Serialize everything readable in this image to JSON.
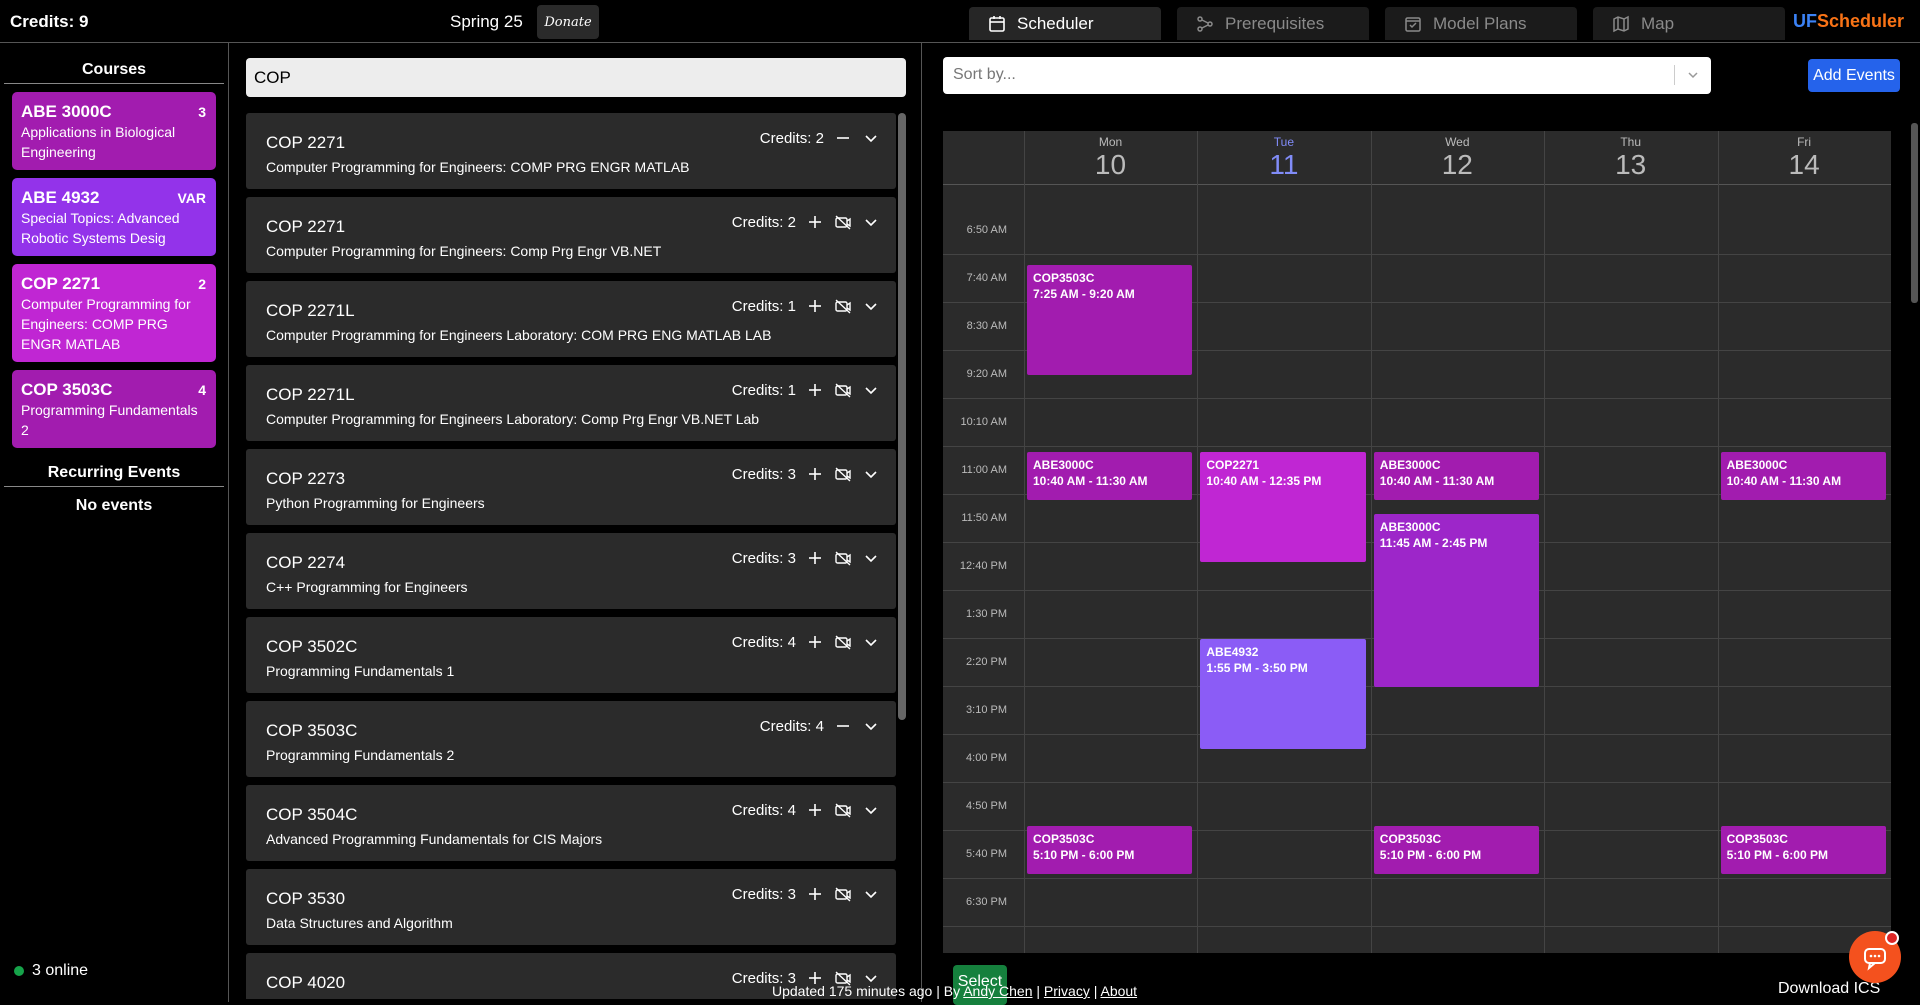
{
  "header": {
    "credits": "Credits: 9",
    "term": "Spring 25",
    "donate": "Donate",
    "tabs": [
      {
        "label": "Scheduler",
        "icon": "calendar-icon"
      },
      {
        "label": "Prerequisites",
        "icon": "graph-icon"
      },
      {
        "label": "Model Plans",
        "icon": "plan-icon"
      },
      {
        "label": "Map",
        "icon": "map-icon"
      }
    ],
    "brand_uf": "UF",
    "brand_rest": "Scheduler"
  },
  "sidebar": {
    "courses_title": "Courses",
    "courses": [
      {
        "code": "ABE 3000C",
        "credits": "3",
        "name": "Applications in Biological Engineering",
        "color": "#a21caf"
      },
      {
        "code": "ABE 4932",
        "credits": "VAR",
        "name": "Special Topics: Advanced Robotic Systems Desig",
        "color": "#9333ea"
      },
      {
        "code": "COP 2271",
        "credits": "2",
        "name": "Computer Programming for Engineers: COMP PRG ENGR MATLAB",
        "color": "#c026d3"
      },
      {
        "code": "COP 3503C",
        "credits": "4",
        "name": "Programming Fundamentals 2",
        "color": "#a21caf"
      }
    ],
    "recurring_title": "Recurring Events",
    "no_events": "No events",
    "online": "3 online"
  },
  "search": {
    "value": "COP"
  },
  "results": [
    {
      "code": "COP 2271",
      "credits": "Credits: 2",
      "name": "Computer Programming for Engineers: COMP PRG ENGR MATLAB",
      "added": true
    },
    {
      "code": "COP 2271",
      "credits": "Credits: 2",
      "name": "Computer Programming for Engineers: Comp Prg Engr VB.NET",
      "added": false
    },
    {
      "code": "COP 2271L",
      "credits": "Credits: 1",
      "name": "Computer Programming for Engineers Laboratory: COM PRG ENG MATLAB LAB",
      "added": false
    },
    {
      "code": "COP 2271L",
      "credits": "Credits: 1",
      "name": "Computer Programming for Engineers Laboratory: Comp Prg Engr VB.NET Lab",
      "added": false
    },
    {
      "code": "COP 2273",
      "credits": "Credits: 3",
      "name": "Python Programming for Engineers",
      "added": false
    },
    {
      "code": "COP 2274",
      "credits": "Credits: 3",
      "name": "C++ Programming for Engineers",
      "added": false
    },
    {
      "code": "COP 3502C",
      "credits": "Credits: 4",
      "name": "Programming Fundamentals 1",
      "added": false
    },
    {
      "code": "COP 3503C",
      "credits": "Credits: 4",
      "name": "Programming Fundamentals 2",
      "added": true
    },
    {
      "code": "COP 3504C",
      "credits": "Credits: 4",
      "name": "Advanced Programming Fundamentals for CIS Majors",
      "added": false
    },
    {
      "code": "COP 3530",
      "credits": "Credits: 3",
      "name": "Data Structures and Algorithm",
      "added": false
    },
    {
      "code": "COP 4020",
      "credits": "Credits: 3",
      "name": "",
      "added": false
    }
  ],
  "calendar": {
    "sort_placeholder": "Sort by...",
    "add_events": "Add Events",
    "days": [
      {
        "name": "Mon",
        "num": "10"
      },
      {
        "name": "Tue",
        "num": "11",
        "today": true
      },
      {
        "name": "Wed",
        "num": "12"
      },
      {
        "name": "Thu",
        "num": "13"
      },
      {
        "name": "Fri",
        "num": "14"
      }
    ],
    "times": [
      "6:50 AM",
      "7:40 AM",
      "8:30 AM",
      "9:20 AM",
      "10:10 AM",
      "11:00 AM",
      "11:50 AM",
      "12:40 PM",
      "1:30 PM",
      "2:20 PM",
      "3:10 PM",
      "4:00 PM",
      "4:50 PM",
      "5:40 PM",
      "6:30 PM"
    ],
    "events": [
      {
        "day": 0,
        "title": "COP3503C",
        "time": "7:25 AM  -  9:20 AM",
        "start": 445,
        "end": 560,
        "color": "#a21caf"
      },
      {
        "day": 0,
        "title": "ABE3000C",
        "time": "10:40 AM  -  11:30 AM",
        "start": 640,
        "end": 690,
        "color": "#a21caf"
      },
      {
        "day": 1,
        "title": "COP2271",
        "time": "10:40 AM  -  12:35 PM",
        "start": 640,
        "end": 755,
        "color": "#c026d3"
      },
      {
        "day": 2,
        "title": "ABE3000C",
        "time": "10:40 AM  -  11:30 AM",
        "start": 640,
        "end": 690,
        "color": "#a21caf"
      },
      {
        "day": 4,
        "title": "ABE3000C",
        "time": "10:40 AM  -  11:30 AM",
        "start": 640,
        "end": 690,
        "color": "#a21caf"
      },
      {
        "day": 2,
        "title": "ABE3000C",
        "time": "11:45 AM  -  2:45 PM",
        "start": 705,
        "end": 885,
        "color": "#9d26c9"
      },
      {
        "day": 1,
        "title": "ABE4932",
        "time": "1:55 PM  -  3:50 PM",
        "start": 835,
        "end": 950,
        "color": "#8b5cf6"
      },
      {
        "day": 0,
        "title": "COP3503C",
        "time": "5:10 PM  -  6:00 PM",
        "start": 1030,
        "end": 1080,
        "color": "#a21caf"
      },
      {
        "day": 2,
        "title": "COP3503C",
        "time": "5:10 PM  -  6:00 PM",
        "start": 1030,
        "end": 1080,
        "color": "#a21caf"
      },
      {
        "day": 4,
        "title": "COP3503C",
        "time": "5:10 PM  -  6:00 PM",
        "start": 1030,
        "end": 1080,
        "color": "#a21caf"
      }
    ],
    "select": "Select",
    "download": "Download ICS"
  },
  "footer": {
    "updated": "Updated 175 minutes ago | By ",
    "author": "Andy Chen",
    "sep1": " | ",
    "privacy": "Privacy",
    "sep2": " | ",
    "about": "About"
  }
}
